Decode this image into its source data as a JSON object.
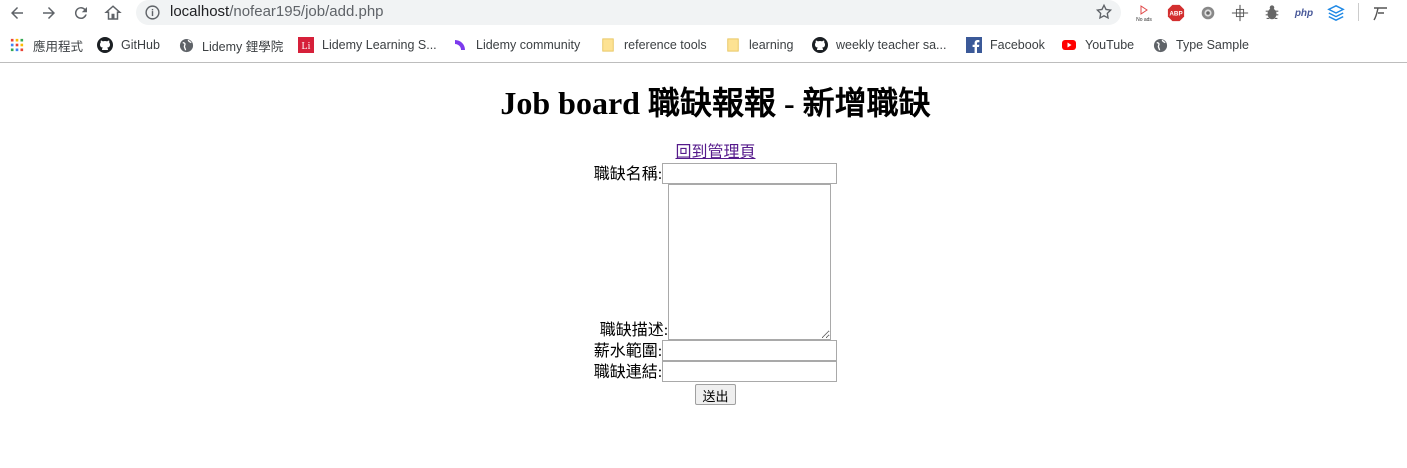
{
  "browser": {
    "url_host": "localhost",
    "url_path": "/nofear195/job/add.php",
    "extensions": [
      {
        "name": "no-ads-extension-icon",
        "label": "No ads"
      },
      {
        "name": "adblock-plus-extension-icon",
        "label": "ABP"
      },
      {
        "name": "gear-extension-icon",
        "label": ""
      },
      {
        "name": "crosshair-extension-icon",
        "label": ""
      },
      {
        "name": "bug-extension-icon",
        "label": ""
      },
      {
        "name": "php-extension-icon",
        "label": "php"
      },
      {
        "name": "layers-extension-icon",
        "label": ""
      },
      {
        "name": "font-extension-icon",
        "label": ""
      }
    ]
  },
  "bookmarks": [
    {
      "label": "應用程式",
      "icon": "apps-grid-icon"
    },
    {
      "label": "GitHub",
      "icon": "github-icon"
    },
    {
      "label": "Lidemy 鋰學院",
      "icon": "globe-icon"
    },
    {
      "label": "Lidemy Learning S...",
      "icon": "lidemy-li-icon"
    },
    {
      "label": "Lidemy community",
      "icon": "purple-arc-icon"
    },
    {
      "label": "reference tools",
      "icon": "folder-icon"
    },
    {
      "label": "learning",
      "icon": "folder-icon"
    },
    {
      "label": "weekly teacher sa...",
      "icon": "github-icon"
    },
    {
      "label": "Facebook",
      "icon": "facebook-icon"
    },
    {
      "label": "YouTube",
      "icon": "youtube-icon"
    },
    {
      "label": "Type Sample",
      "icon": "globe-icon"
    }
  ],
  "page": {
    "title": "Job board 職缺報報 - 新增職缺",
    "back_link": "回到管理頁",
    "fields": {
      "title_label": "職缺名稱:",
      "title_value": "",
      "description_label": "職缺描述:",
      "description_value": "",
      "salary_label": "薪水範圍:",
      "salary_value": "",
      "link_label": "職缺連結:",
      "link_value": ""
    },
    "submit_label": "送出"
  },
  "colors": {
    "link_visited": "#551a8b",
    "omnibox_bg": "#f1f3f4",
    "chrome_icon": "#5f6368"
  }
}
